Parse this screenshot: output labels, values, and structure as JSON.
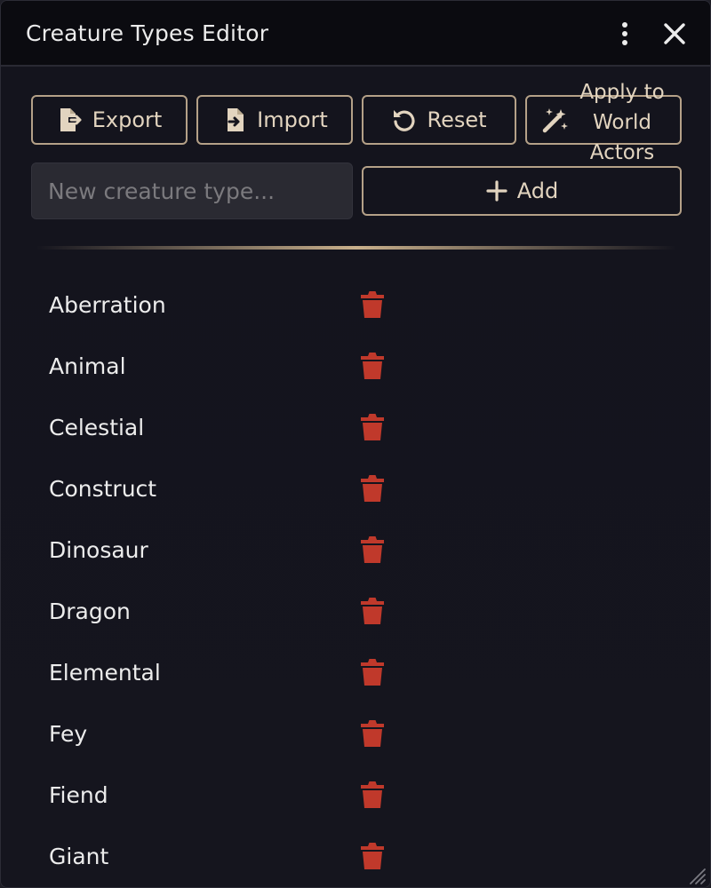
{
  "window": {
    "title": "Creature Types Editor"
  },
  "toolbar": {
    "export_label": "Export",
    "import_label": "Import",
    "reset_label": "Reset",
    "apply_label": "Apply to World Actors"
  },
  "new_type": {
    "placeholder": "New creature type...",
    "value": "",
    "add_label": "Add"
  },
  "creature_types": [
    "Aberration",
    "Animal",
    "Celestial",
    "Construct",
    "Dinosaur",
    "Dragon",
    "Elemental",
    "Fey",
    "Fiend",
    "Giant"
  ],
  "colors": {
    "accent": "#b5a188",
    "delete": "#c0392b",
    "background": "#14141d"
  },
  "icons": {
    "menu": "kebab-menu-icon",
    "close": "close-icon",
    "export": "file-export-icon",
    "import": "file-import-icon",
    "reset": "rotate-left-icon",
    "apply": "magic-wand-icon",
    "add": "plus-icon",
    "delete": "trash-icon"
  }
}
